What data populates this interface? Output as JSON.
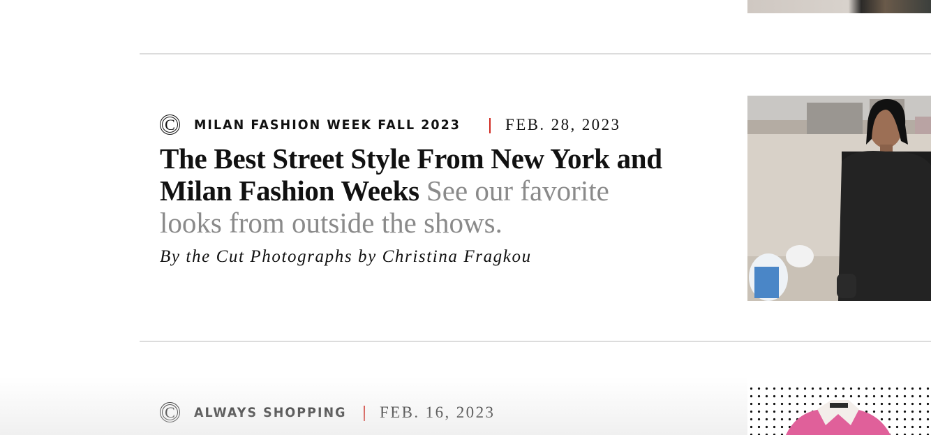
{
  "articles": [
    {
      "rubric": "MILAN FASHION WEEK FALL 2023",
      "date": "FEB. 28, 2023",
      "headline": "The Best Street Style From New York and Milan Fashion Weeks",
      "dek": "See our favorite looks from outside the shows.",
      "byline": "By the Cut Photographs by Christina Fragkou",
      "logo": "C"
    },
    {
      "rubric": "ALWAYS SHOPPING",
      "date": "FEB. 16, 2023",
      "logo": "C"
    }
  ],
  "colors": {
    "separator": "#d0281f",
    "dek": "#8a8a8a",
    "divider": "#dcdcdc"
  },
  "icons": {
    "logo": "the-cut-logo-icon"
  }
}
